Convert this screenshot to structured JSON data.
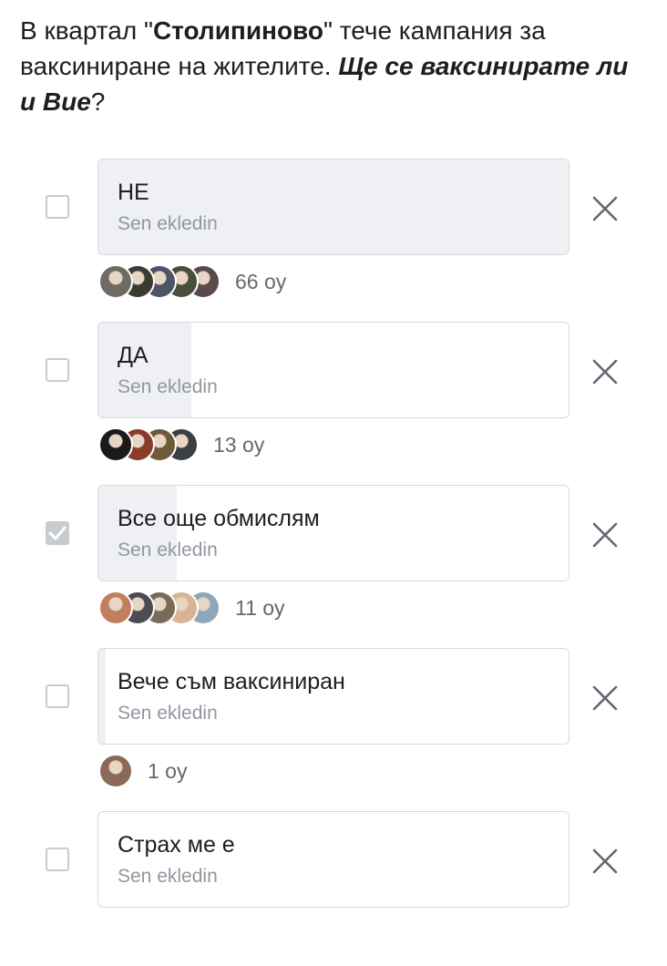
{
  "question": {
    "part1": "В квартал \"",
    "bold": "Столипиново",
    "part2": "\" тече кампания за ваксиниране на жителите. ",
    "bold_italic": "Ще се ваксинирате ли и Вие",
    "part3": "?"
  },
  "options": [
    {
      "label": "НЕ",
      "added_by": "Sen ekledin",
      "votes": "66 oy",
      "checked": false,
      "vote_share": 1.0,
      "voter_colors": [
        "#6f6a62",
        "#3b3a33",
        "#4d5566",
        "#4a4f3c",
        "#5b4a4d"
      ]
    },
    {
      "label": "ДА",
      "added_by": "Sen ekledin",
      "votes": "13 oy",
      "checked": false,
      "vote_share": 0.197,
      "voter_colors": [
        "#1a1a1a",
        "#8a3b2a",
        "#6d5b3a",
        "#3a3f44"
      ]
    },
    {
      "label": "Все още обмислям",
      "added_by": "Sen ekledin",
      "votes": "11 oy",
      "checked": true,
      "vote_share": 0.167,
      "voter_colors": [
        "#c08060",
        "#4b4d53",
        "#7b6a56",
        "#d9b394",
        "#8fa7b8"
      ]
    },
    {
      "label": "Вече съм ваксиниран",
      "added_by": "Sen ekledin",
      "votes": "1 oy",
      "checked": false,
      "vote_share": 0.015,
      "voter_colors": [
        "#8d6a58"
      ]
    },
    {
      "label": "Страх ме е",
      "added_by": "Sen ekledin",
      "votes": "",
      "checked": false,
      "vote_share": 0,
      "voter_colors": []
    }
  ]
}
